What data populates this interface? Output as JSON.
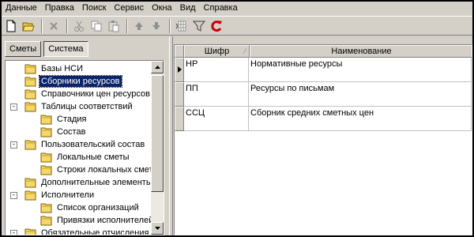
{
  "menu": [
    "Данные",
    "Правка",
    "Поиск",
    "Сервис",
    "Окна",
    "Вид",
    "Справка"
  ],
  "toolbar": {
    "buttons": [
      "new-icon",
      "open-icon",
      "delete-icon",
      "cut-icon",
      "copy-icon",
      "paste-icon",
      "move-up-icon",
      "move-down-icon",
      "insert-column-icon",
      "filter-icon",
      "refresh-icon"
    ],
    "accent": "#cc0000"
  },
  "tabs": [
    {
      "label": "Сметы",
      "active": false
    },
    {
      "label": "Система",
      "active": true
    }
  ],
  "tree": [
    {
      "label": "Базы НСИ",
      "level": 1,
      "expander": "",
      "selected": false
    },
    {
      "label": "Сборники ресурсов",
      "level": 1,
      "expander": "",
      "selected": true
    },
    {
      "label": "Справочники цен ресурсов",
      "level": 1,
      "expander": "",
      "selected": false
    },
    {
      "label": "Таблицы соответствий",
      "level": 1,
      "expander": "-",
      "selected": false
    },
    {
      "label": "Стадия",
      "level": 2,
      "expander": "",
      "selected": false
    },
    {
      "label": "Состав",
      "level": 2,
      "expander": "",
      "selected": false
    },
    {
      "label": "Пользовательский состав",
      "level": 1,
      "expander": "-",
      "selected": false
    },
    {
      "label": "Локальные сметы",
      "level": 2,
      "expander": "",
      "selected": false
    },
    {
      "label": "Строки локальных смет",
      "level": 2,
      "expander": "",
      "selected": false
    },
    {
      "label": "Дополнительные элементы",
      "level": 1,
      "expander": "",
      "selected": false
    },
    {
      "label": "Исполнители",
      "level": 1,
      "expander": "-",
      "selected": false
    },
    {
      "label": "Список организаций",
      "level": 2,
      "expander": "",
      "selected": false
    },
    {
      "label": "Привязки исполнителей",
      "level": 2,
      "expander": "",
      "selected": false
    },
    {
      "label": "Обязательные отчисления",
      "level": 1,
      "expander": "-",
      "selected": false
    }
  ],
  "grid": {
    "columns": {
      "code": "Шифр",
      "name": "Наименование"
    },
    "rows": [
      {
        "code": "НР",
        "name": "Нормативные ресурсы",
        "current": true
      },
      {
        "code": "ПП",
        "name": "Ресурсы по письмам",
        "current": false
      },
      {
        "code": "ССЦ",
        "name": "Сборник средних сметных цен",
        "current": false
      }
    ]
  }
}
